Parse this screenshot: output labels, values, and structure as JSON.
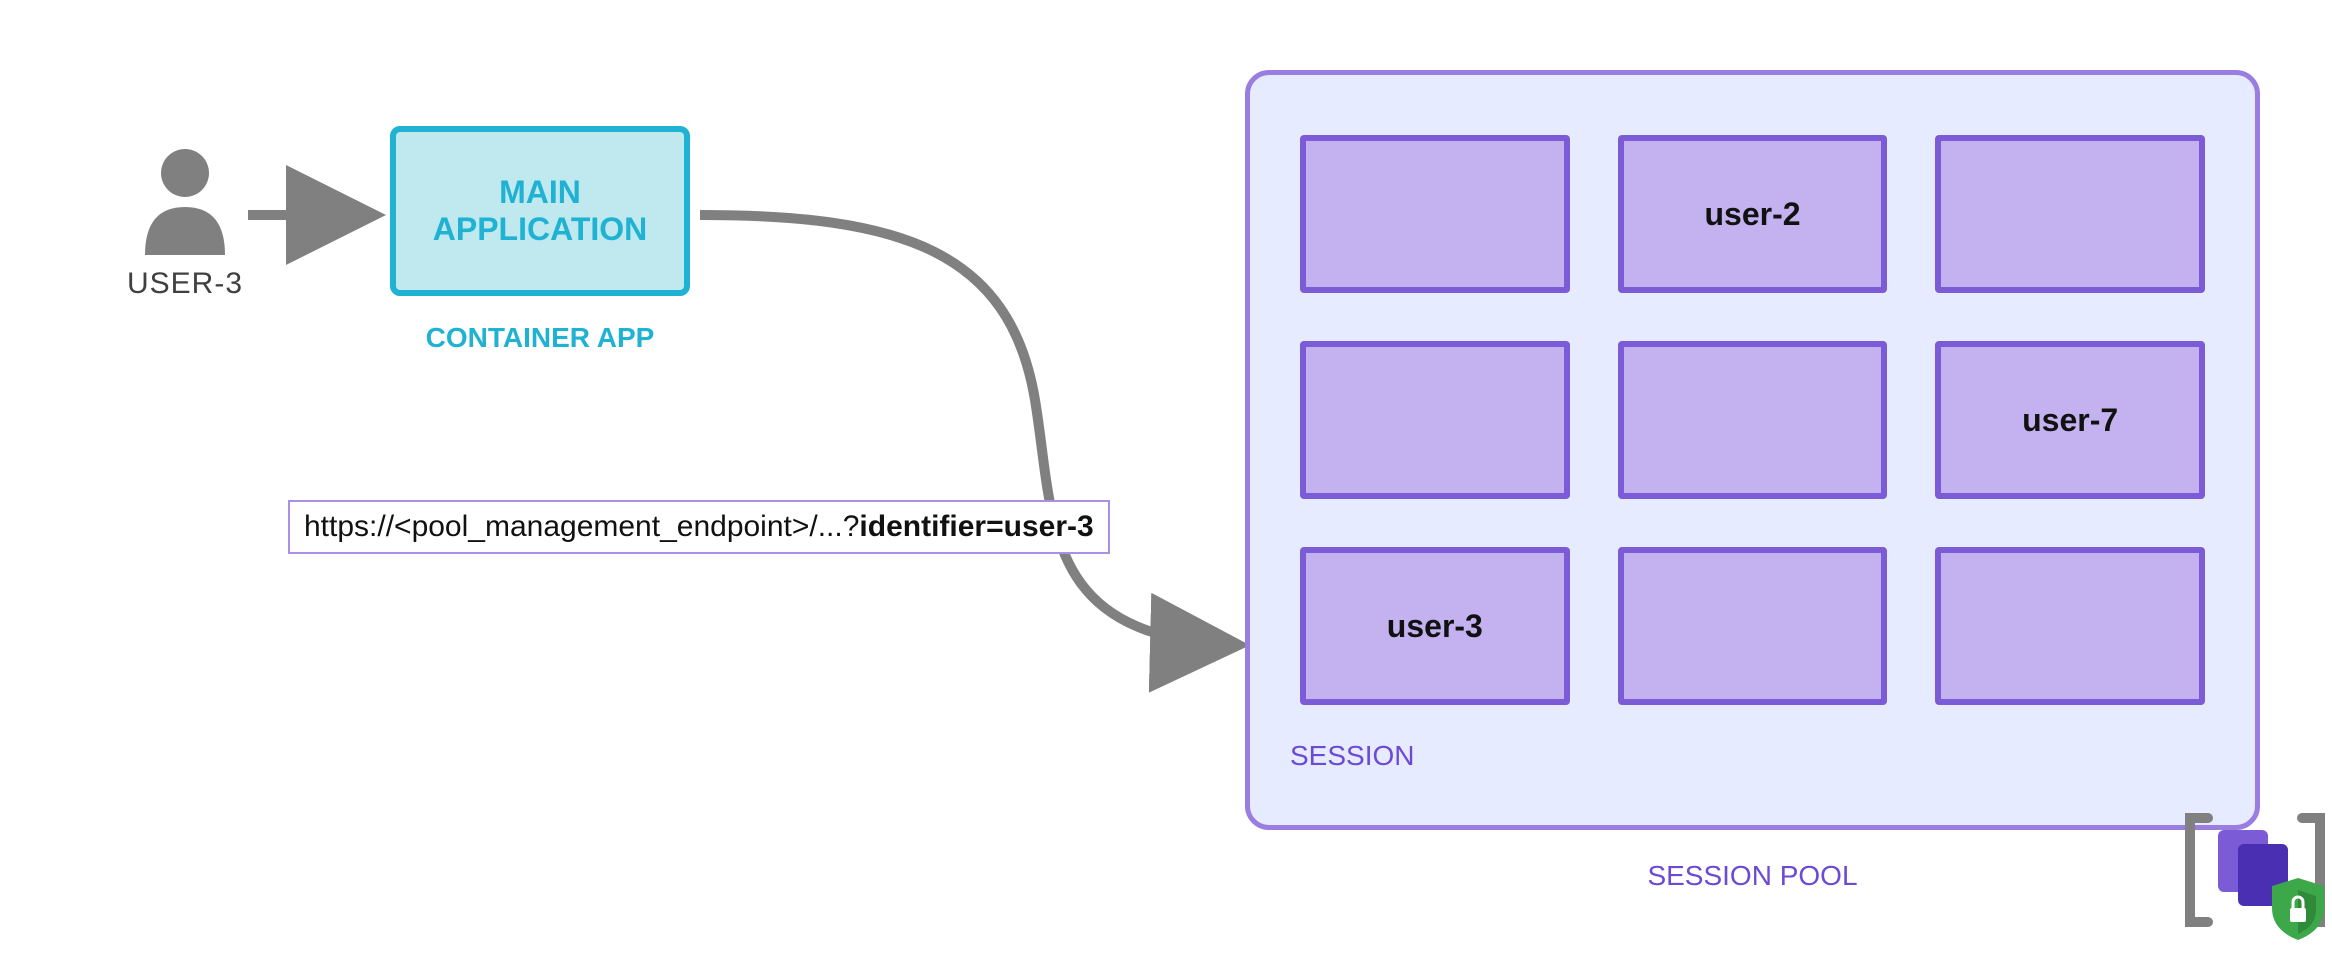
{
  "colors": {
    "user_icon": "#808080",
    "arrow": "#808080",
    "app_border": "#1fb2d3",
    "app_fill": "#bfe8ef",
    "pool_border": "#9a7de0",
    "pool_fill": "#e7ebff",
    "session_border": "#7b5cd6",
    "session_fill": "#c3b2ef",
    "purple_text": "#6b4ad6"
  },
  "user": {
    "label": "USER-3"
  },
  "app": {
    "title_line1": "MAIN",
    "title_line2": "APPLICATION",
    "subtitle": "CONTAINER APP"
  },
  "request": {
    "url_prefix": "https://<pool_management_endpoint>/...?",
    "url_query": "identifier=user-3"
  },
  "pool": {
    "panel_label": "SESSION POOL",
    "session_label": "SESSION",
    "cells": [
      {
        "text": ""
      },
      {
        "text": "user-2"
      },
      {
        "text": ""
      },
      {
        "text": ""
      },
      {
        "text": ""
      },
      {
        "text": "user-7"
      },
      {
        "text": "user-3"
      },
      {
        "text": ""
      },
      {
        "text": ""
      }
    ]
  }
}
